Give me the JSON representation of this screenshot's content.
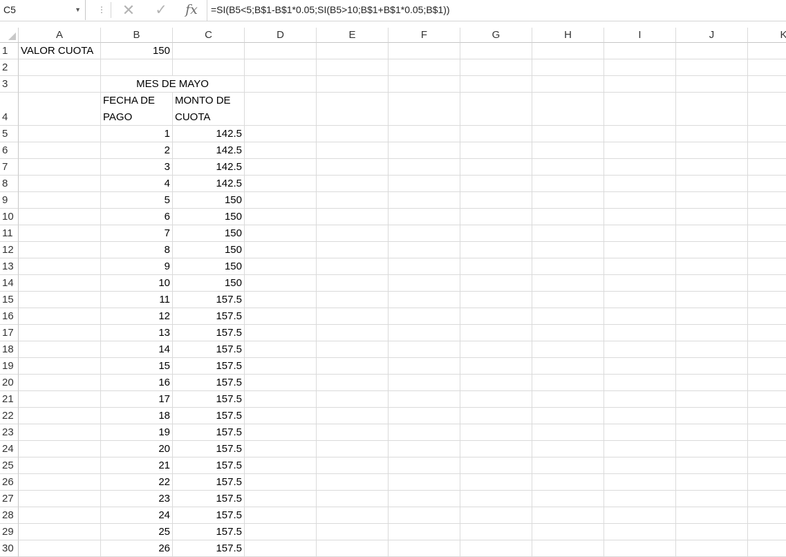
{
  "formula_bar": {
    "name_box": "C5",
    "dots_icon": "vertical-ellipsis",
    "cancel_icon": "cancel-x",
    "enter_icon": "check-mark",
    "fx_label": "fx",
    "formula": "=SI(B5<5;B$1-B$1*0.05;SI(B5>10;B$1+B$1*0.05;B$1))"
  },
  "columns": [
    "A",
    "B",
    "C",
    "D",
    "E",
    "F",
    "G",
    "H",
    "I",
    "J",
    "K"
  ],
  "rows": [
    "1",
    "2",
    "3",
    "4",
    "5",
    "6",
    "7",
    "8",
    "9",
    "10",
    "11",
    "12",
    "13",
    "14",
    "15",
    "16",
    "17",
    "18",
    "19",
    "20",
    "21",
    "22",
    "23",
    "24",
    "25",
    "26",
    "27",
    "28",
    "29",
    "30"
  ],
  "cells": {
    "a1": "VALOR CUOTA",
    "b1": "150",
    "b3c3": "MES DE MAYO",
    "b4_line1": "FECHA DE",
    "b4_line2": "PAGO",
    "c4_line1": "MONTO DE",
    "c4_line2": "CUOTA"
  },
  "table": {
    "fecha_de_pago": [
      "1",
      "2",
      "3",
      "4",
      "5",
      "6",
      "7",
      "8",
      "9",
      "10",
      "11",
      "12",
      "13",
      "14",
      "15",
      "16",
      "17",
      "18",
      "19",
      "20",
      "21",
      "22",
      "23",
      "24",
      "25",
      "26"
    ],
    "monto_de_cuota": [
      "142.5",
      "142.5",
      "142.5",
      "142.5",
      "150",
      "150",
      "150",
      "150",
      "150",
      "150",
      "157.5",
      "157.5",
      "157.5",
      "157.5",
      "157.5",
      "157.5",
      "157.5",
      "157.5",
      "157.5",
      "157.5",
      "157.5",
      "157.5",
      "157.5",
      "157.5",
      "157.5",
      "157.5"
    ]
  },
  "selected_cell": "C5"
}
